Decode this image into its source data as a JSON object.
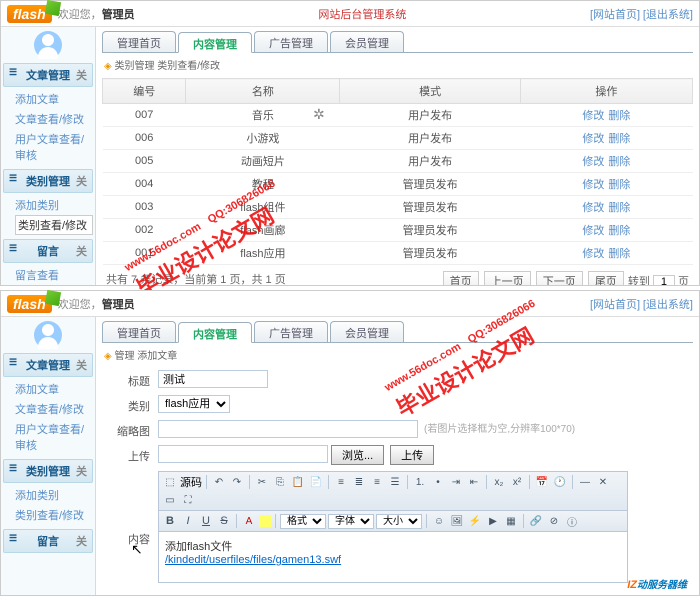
{
  "header": {
    "logo": "flash",
    "welcome_prefix": "欢迎您，",
    "welcome_user": "管理员",
    "system_title": "网站后台管理系统",
    "link_home": "[网站首页]",
    "link_logout": "[退出系统]"
  },
  "sidebar": {
    "groups": [
      {
        "title": "文章管理",
        "collapse": "关",
        "items": [
          "添加文章",
          "文章查看/修改",
          "用户文章查看/审核"
        ]
      },
      {
        "title": "类别管理",
        "collapse": "关",
        "items": [
          "添加类别",
          "类别查看/修改"
        ]
      },
      {
        "title": "留言",
        "collapse": "关",
        "items": [
          "留言查看"
        ]
      }
    ],
    "active_top": "类别查看/修改",
    "groups_bottom": [
      {
        "title": "文章管理",
        "collapse": "关",
        "items": [
          "添加文章",
          "文章查看/修改",
          "用户文章查看/审核"
        ]
      },
      {
        "title": "类别管理",
        "collapse": "关",
        "items": [
          "添加类别",
          "类别查看/修改"
        ]
      },
      {
        "title": "留言",
        "collapse": "关",
        "items": []
      }
    ]
  },
  "tabs": [
    "管理首页",
    "内容管理",
    "广告管理",
    "会员管理"
  ],
  "active_tab": "内容管理",
  "crumb_top": "类别管理 类别查看/修改",
  "crumb_bottom": "管理 添加文章",
  "table": {
    "cols": [
      "编号",
      "名称",
      "模式",
      "操作"
    ],
    "rows": [
      {
        "id": "007",
        "name": "音乐",
        "mode": "用户发布"
      },
      {
        "id": "006",
        "name": "小游戏",
        "mode": "用户发布"
      },
      {
        "id": "005",
        "name": "动画短片",
        "mode": "用户发布"
      },
      {
        "id": "004",
        "name": "教程",
        "mode": "管理员发布"
      },
      {
        "id": "003",
        "name": "flash组件",
        "mode": "管理员发布"
      },
      {
        "id": "002",
        "name": "flash画廊",
        "mode": "管理员发布"
      },
      {
        "id": "001",
        "name": "flash应用",
        "mode": "管理员发布"
      }
    ],
    "op_edit": "修改",
    "op_del": "删除"
  },
  "pager": {
    "info": "共有 7 条记录，当前第 1 页，共 1 页",
    "first": "首页",
    "prev": "上一页",
    "next": "下一页",
    "last": "尾页",
    "goto_prefix": "转到",
    "goto_val": "1",
    "goto_suffix": "页"
  },
  "form": {
    "label_title": "标题",
    "val_title": "测试",
    "label_cat": "类别",
    "val_cat": "flash应用",
    "label_thumb": "缩略图",
    "hint_thumb": "(若图片选择框为空,分辨率100*70)",
    "label_upload": "上传",
    "btn_browse": "浏览...",
    "btn_upload": "上传",
    "label_content": "内容",
    "editor_text": "添加flash文件",
    "editor_link": "/kindedit/userfiles/files/gamen13.swf",
    "tb_src": "源码",
    "tb_fmt": "格式",
    "tb_font": "字体",
    "tb_size": "大小"
  },
  "watermark": {
    "site": "www.56doc.com",
    "qq": "QQ:306826066",
    "cn": "毕业设计论文网",
    "footer_brand": "IZ",
    "footer_cn": "动服务器维"
  }
}
